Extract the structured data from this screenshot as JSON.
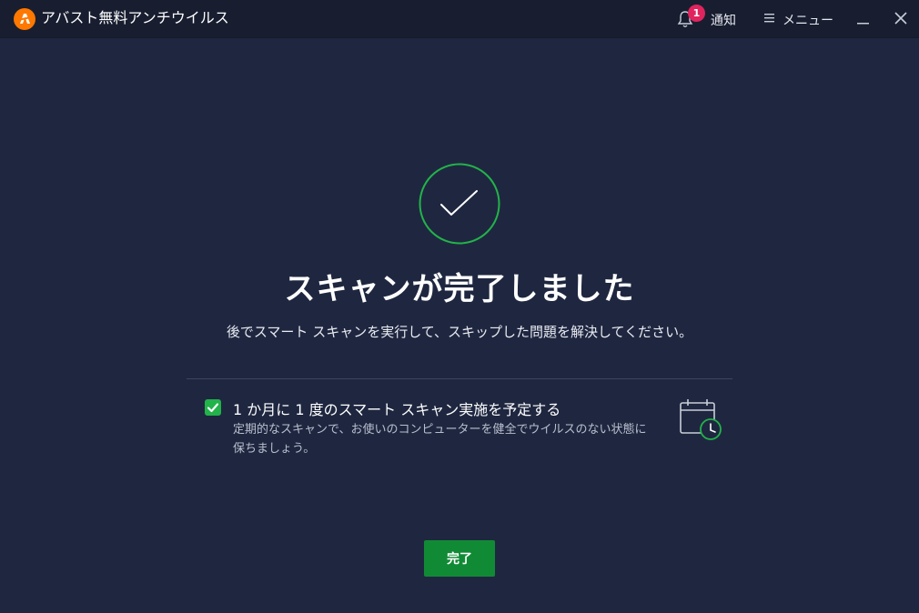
{
  "titlebar": {
    "app_title": "アバスト無料アンチウイルス",
    "notification_count": "1",
    "notification_label": "通知",
    "menu_label": "メニュー",
    "logo_icon": "avast-logo-icon",
    "accent_orange": "#ff7800"
  },
  "main": {
    "status_icon": "checkmark-circle-icon",
    "headline": "スキャンが完了しました",
    "subtext": "後でスマート スキャンを実行して、スキップした問題を解決してください。",
    "schedule_option": {
      "checked": true,
      "label": "1 か月に 1 度のスマート スキャン実施を予定する",
      "description": "定期的なスキャンで、お使いのコンピューターを健全でウイルスのない状態に保ちましょう。",
      "icon": "calendar-clock-icon"
    },
    "done_button": "完了"
  },
  "colors": {
    "background": "#1f2740",
    "titlebar": "#181e30",
    "success_green": "#22b34a",
    "button_green": "#118a35",
    "badge_red": "#e0245e"
  }
}
